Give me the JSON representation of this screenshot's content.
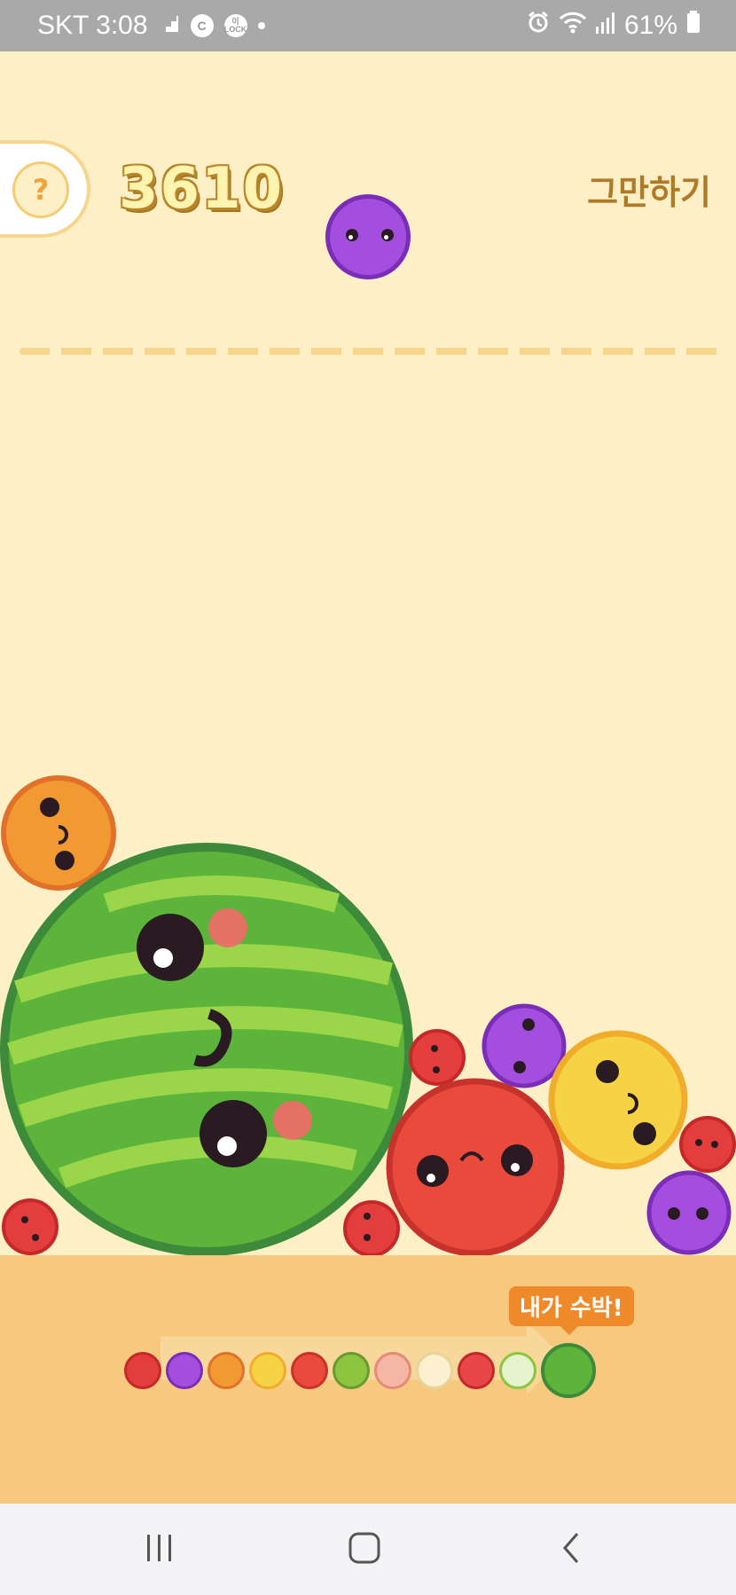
{
  "status_bar": {
    "carrier_time": "SKT 3:08",
    "lock_icon_text": "이 LOCK",
    "c_icon_text": "C",
    "battery": "61%",
    "icons": [
      "signal-steps-icon",
      "c-circle-icon",
      "lock-circle-icon",
      "notification-dot-icon",
      "alarm-icon",
      "wifi-icon",
      "cell-signal-icon",
      "battery-icon"
    ]
  },
  "game": {
    "score": "3610",
    "help_label": "?",
    "quit_label": "그만하기",
    "colors": {
      "background": "#fdf0c7",
      "floor": "#f7c97f",
      "dash": "#f7d58c",
      "accent": "#ee8a2a",
      "score_outline": "#b8862a",
      "quit_text": "#b07b29"
    },
    "next_fruit": "grape",
    "field_fruits": [
      "orange",
      "watermelon",
      "cherry",
      "strawberry",
      "grape",
      "persimmon",
      "apple",
      "strawberry",
      "cherry",
      "grape",
      "strawberry"
    ]
  },
  "evolution": {
    "callout": "내가 수박!",
    "chain": [
      "cherry",
      "grape",
      "orange",
      "persimmon",
      "apple",
      "kiwi",
      "peach",
      "pear",
      "tomato",
      "melon",
      "watermelon"
    ]
  },
  "nav_bar": {
    "icons": [
      "recent-apps-icon",
      "home-icon",
      "back-icon"
    ]
  }
}
